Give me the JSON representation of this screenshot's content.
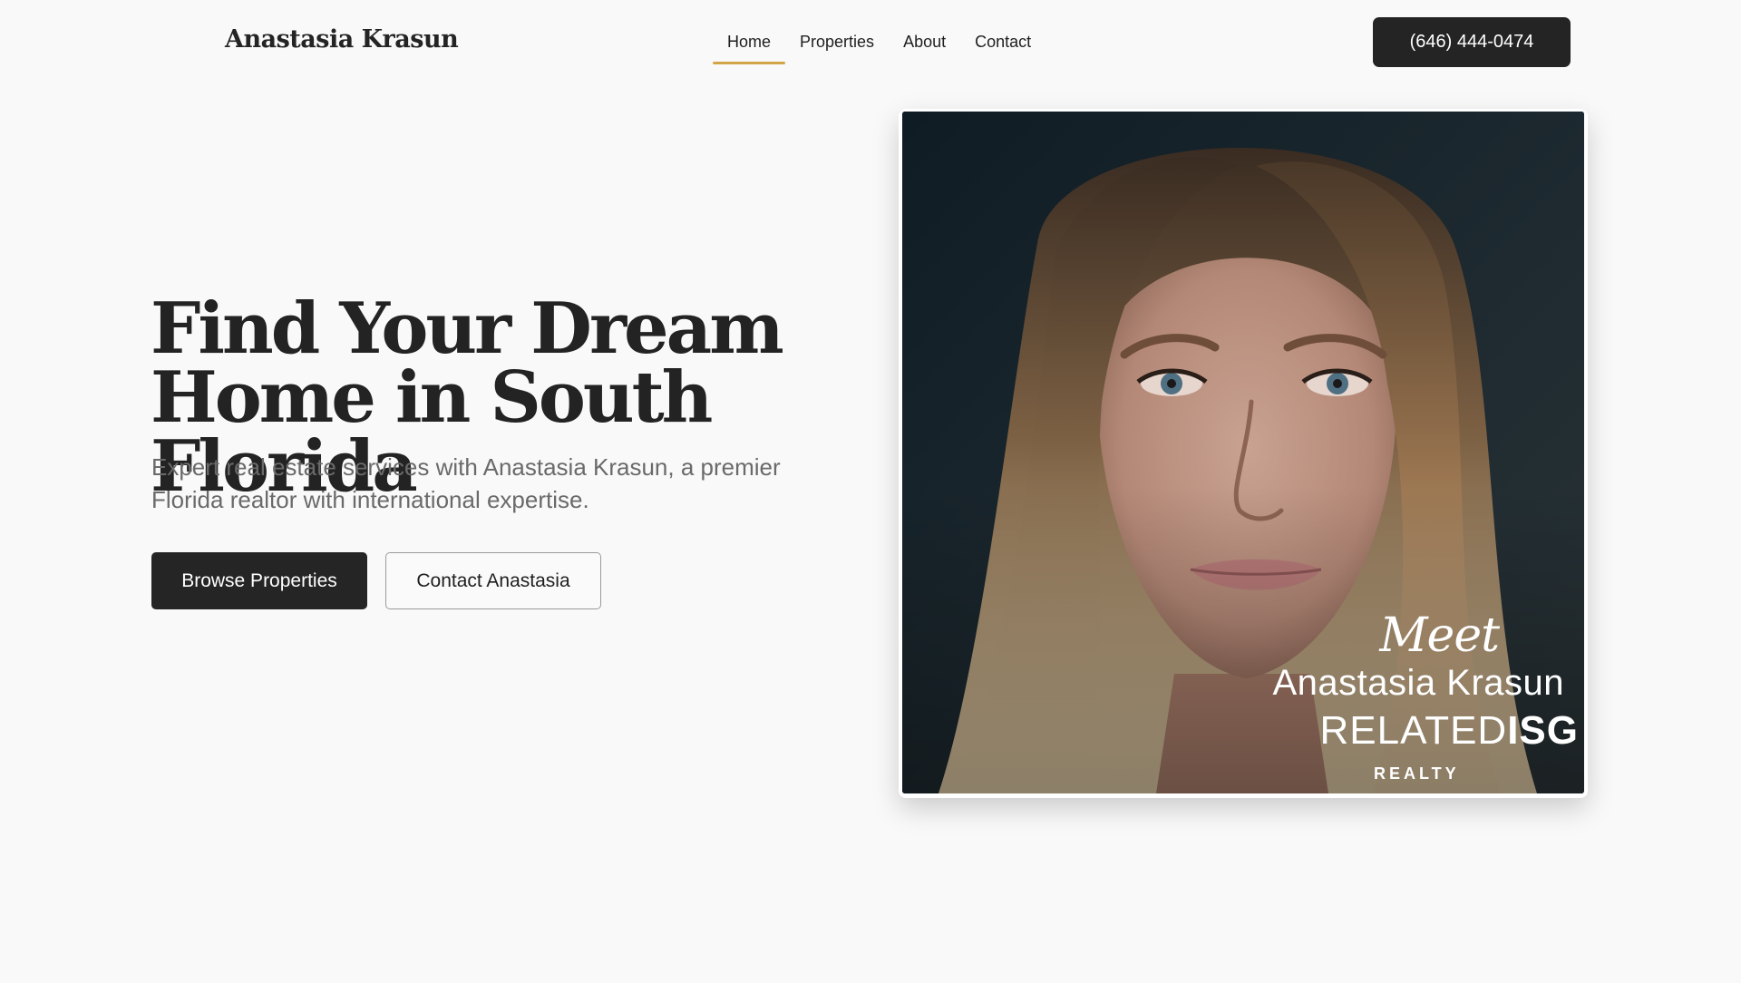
{
  "header": {
    "brand": "Anastasia Krasun",
    "nav": [
      {
        "label": "Home",
        "active": true
      },
      {
        "label": "Properties"
      },
      {
        "label": "About"
      },
      {
        "label": "Contact"
      }
    ],
    "phone_label": "(646) 444-0474"
  },
  "hero": {
    "title_line1": "Find Your Dream",
    "title_line2": "Home in South Florida",
    "subtitle": "Expert real estate services with Anastasia Krasun, a premier Florida realtor with international expertise.",
    "primary_button": "Browse Properties",
    "secondary_button": "Contact Anastasia"
  },
  "portrait": {
    "meet": "Meet",
    "name": "Anastasia Krasun",
    "logo_light": "RELATED",
    "logo_bold": "ISG",
    "logo_sub": "REALTY"
  },
  "colors": {
    "accent": "#d4a548",
    "dark": "#242424",
    "background": "#f9f9f9"
  }
}
